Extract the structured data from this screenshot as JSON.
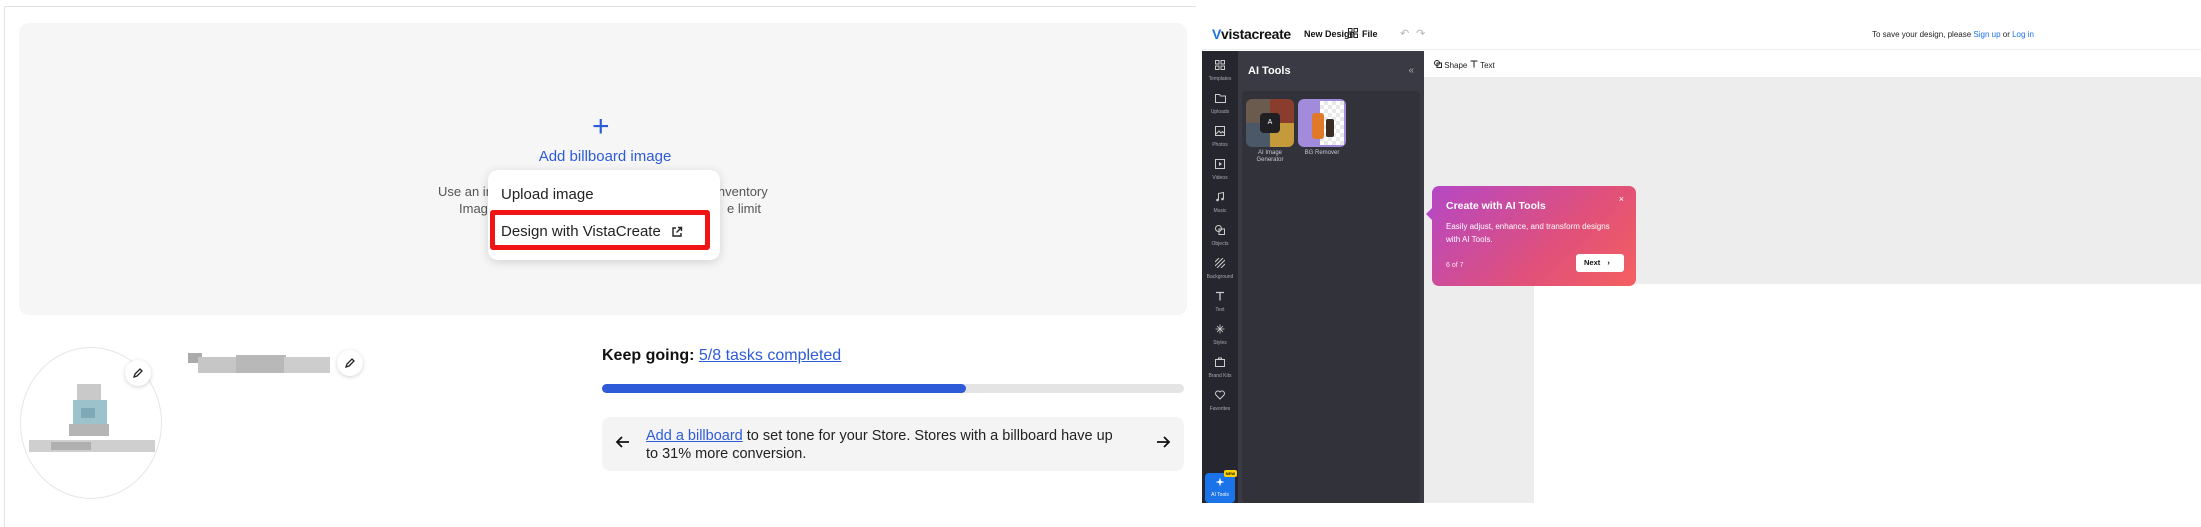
{
  "left": {
    "billboard": {
      "plus_glyph": "+",
      "add_label": "Add billboard image",
      "help_line1_start": "Use an im",
      "help_line1_end": "inventory",
      "help_line2_start": "Imag",
      "help_line2_end": "e limit"
    },
    "popover": {
      "upload_label": "Upload image",
      "design_label": "Design with VistaCreate",
      "highlight_color": "#f01414"
    },
    "progress": {
      "keep_prefix": "Keep going:",
      "tasks_link": "5/8 tasks completed",
      "completed": 5,
      "total": 8
    },
    "tip": {
      "link_text": "Add a billboard",
      "text": " to set tone for your Store. Stores with a billboard have up to 31% more conversion."
    },
    "accent_color": "#2e5bd8"
  },
  "right": {
    "topbar": {
      "logo_mark": "V",
      "logo_text": "vistacreate",
      "new_design": "New Design",
      "file": "File",
      "undo_icon": "↶",
      "redo_icon": "↷",
      "save_prefix": "To save your design, please ",
      "sign_up": "Sign up",
      "or": " or ",
      "log_in": "Log in"
    },
    "rail": [
      {
        "label": "Templates",
        "icon": "grid-icon"
      },
      {
        "label": "Uploads",
        "icon": "folder-icon"
      },
      {
        "label": "Photos",
        "icon": "image-icon"
      },
      {
        "label": "Videos",
        "icon": "play-icon"
      },
      {
        "label": "Music",
        "icon": "music-icon"
      },
      {
        "label": "Objects",
        "icon": "shapes-icon"
      },
      {
        "label": "Background",
        "icon": "hatch-icon"
      },
      {
        "label": "Text",
        "icon": "text-icon"
      },
      {
        "label": "Styles",
        "icon": "sparkle-icon"
      },
      {
        "label": "Brand Kits",
        "icon": "briefcase-icon"
      },
      {
        "label": "Favorites",
        "icon": "heart-icon"
      }
    ],
    "ai_tools_rail": {
      "label": "AI Tools",
      "badge": "NEW"
    },
    "panel": {
      "title": "AI Tools",
      "collapse_icon": "«",
      "tools": [
        {
          "label": "AI Image Generator"
        },
        {
          "label": "BG Remover"
        }
      ]
    },
    "subbar": {
      "shape": "Shape",
      "text": "Text"
    },
    "tour": {
      "title": "Create with AI Tools",
      "body": "Easily adjust, enhance, and transform designs with AI Tools.",
      "step": "6 of 7",
      "next": "Next",
      "close_icon": "×"
    }
  }
}
